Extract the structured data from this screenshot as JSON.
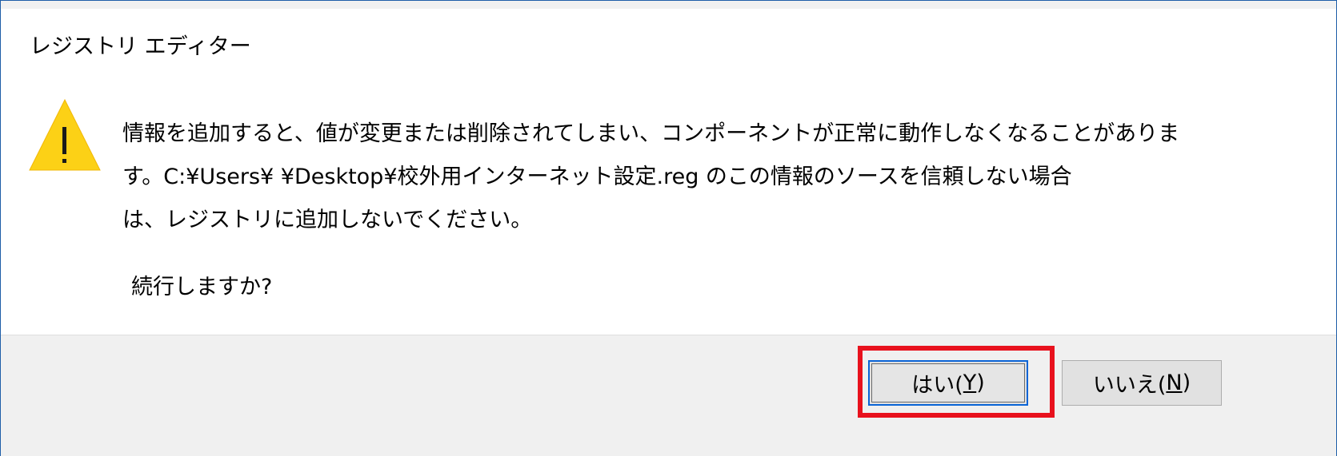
{
  "dialog": {
    "title": "レジストリ エディター",
    "icon": "warning-icon",
    "message_lines": [
      "情報を追加すると、値が変更または削除されてしまい、コンポーネントが正常に動作しなくなることがありま",
      "す。C:¥Users¥              ¥Desktop¥校外用インターネット設定.reg のこの情報のソースを信頼しない場合",
      "は、レジストリに追加しないでください。"
    ],
    "question": "続行しますか?"
  },
  "buttons": {
    "yes": {
      "label": "はい(",
      "mnemonic": "Y",
      "suffix": ")"
    },
    "no": {
      "label": "いいえ(",
      "mnemonic": "N",
      "suffix": ")"
    }
  },
  "colors": {
    "dialog_border": "#1f5ea8",
    "footer_bg": "#f0f0f0",
    "button_bg": "#e1e1e1",
    "focus_border": "#0a64d6",
    "highlight_box": "#e8111d",
    "warning_yellow": "#fcd116"
  }
}
